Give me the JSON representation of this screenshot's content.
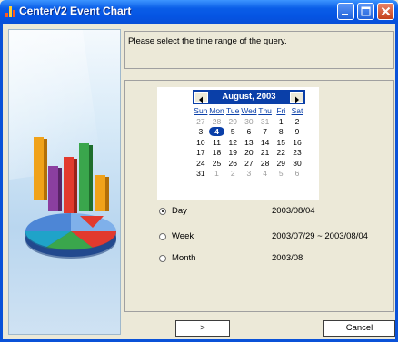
{
  "window": {
    "title": "CenterV2 Event Chart"
  },
  "info": {
    "message": "Please select the time range of the query."
  },
  "calendar": {
    "month_label": "August, 2003",
    "weekdays": [
      "Sun",
      "Mon",
      "Tue",
      "Wed",
      "Thu",
      "Fri",
      "Sat"
    ],
    "weeks": [
      [
        "27",
        "28",
        "29",
        "30",
        "31",
        "1",
        "2"
      ],
      [
        "3",
        "4",
        "5",
        "6",
        "7",
        "8",
        "9"
      ],
      [
        "10",
        "11",
        "12",
        "13",
        "14",
        "15",
        "16"
      ],
      [
        "17",
        "18",
        "19",
        "20",
        "21",
        "22",
        "23"
      ],
      [
        "24",
        "25",
        "26",
        "27",
        "28",
        "29",
        "30"
      ],
      [
        "31",
        "1",
        "2",
        "3",
        "4",
        "5",
        "6"
      ]
    ],
    "selected_day": "4"
  },
  "options": [
    {
      "label": "Day",
      "value": "2003/08/04",
      "selected": true
    },
    {
      "label": "Week",
      "value": "2003/07/29 ~ 2003/08/04",
      "selected": false
    },
    {
      "label": "Month",
      "value": "2003/08",
      "selected": false
    }
  ],
  "buttons": {
    "next_label": ">",
    "cancel_label": "Cancel"
  },
  "colors": {
    "title_bar": "#0554e3",
    "calendar_header": "#0a3fa8",
    "selected_day": "#0a3fa8"
  },
  "icons": {
    "app": "bar-chart-icon",
    "minimize": "minimize-icon",
    "maximize": "maximize-icon",
    "close": "close-icon",
    "prev": "triangle-left-icon",
    "next": "triangle-right-icon"
  }
}
